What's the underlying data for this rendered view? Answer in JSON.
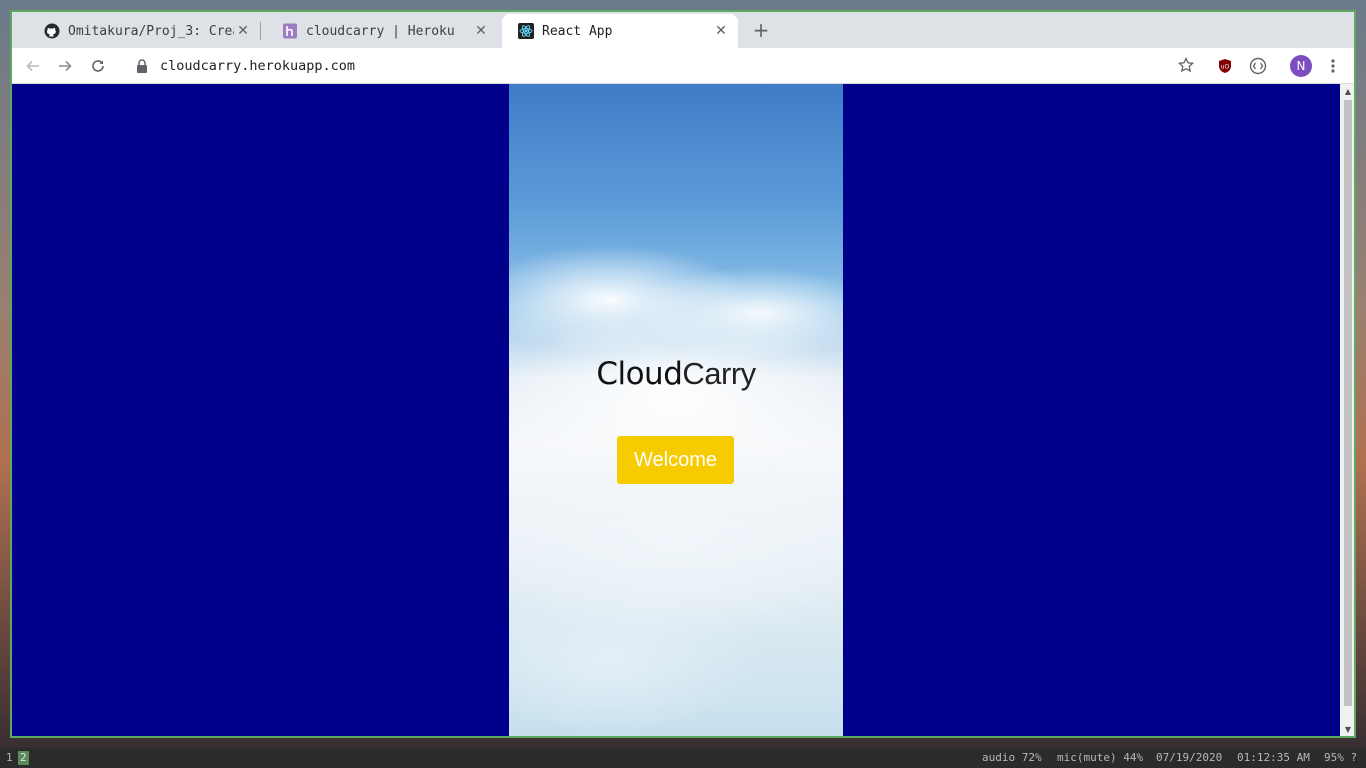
{
  "browser": {
    "tabs": [
      {
        "title": "Omitakura/Proj_3: Crea",
        "favicon": "github-icon",
        "active": false
      },
      {
        "title": "cloudcarry | Heroku",
        "favicon": "heroku-icon",
        "active": false
      },
      {
        "title": "React App",
        "favicon": "react-icon",
        "active": true
      }
    ],
    "close_glyph": "✕",
    "new_tab_glyph": "+",
    "url": "cloudcarry.herokuapp.com",
    "profile_initial": "N",
    "colors": {
      "frame": "#dee1e6",
      "active_tab": "#ffffff",
      "window_border": "#5fa85f",
      "avatar": "#7b4dbf"
    }
  },
  "page": {
    "background": "#00008b",
    "logo_bold": "Cloud",
    "logo_light": "Carry",
    "welcome_button": "Welcome",
    "button_color": "#f6cc00"
  },
  "taskbar": {
    "workspaces": [
      "1",
      "2"
    ],
    "active_workspace": "2",
    "audio": "audio 72%",
    "mic": "mic(mute) 44%",
    "date": "07/19/2020",
    "time": "01:12:35 AM",
    "battery": "95% ?"
  }
}
